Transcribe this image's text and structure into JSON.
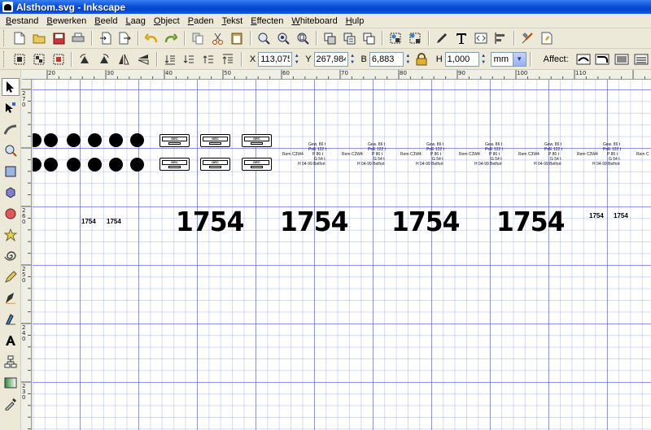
{
  "window": {
    "title": "Alsthom.svg - Inkscape"
  },
  "menu": [
    "Bestand",
    "Bewerken",
    "Beeld",
    "Laag",
    "Object",
    "Paden",
    "Tekst",
    "Effecten",
    "Whiteboard",
    "Hulp"
  ],
  "controls": {
    "x_label": "X",
    "x_value": "113,075",
    "y_label": "Y",
    "y_value": "267,984",
    "w_label": "B",
    "w_value": "6,883",
    "h_label": "H",
    "h_value": "1,000",
    "unit": "mm",
    "affect_label": "Affect:"
  },
  "ruler": {
    "top": [
      "20",
      "30",
      "40",
      "50",
      "60",
      "70",
      "80",
      "90",
      "100",
      "110"
    ],
    "left": [
      "270",
      "260",
      "250",
      "240",
      "230"
    ]
  },
  "drawing": {
    "plate_text": "GEC ALSTHOM",
    "number": "1754",
    "weight": {
      "gew": "Gew.  86 t",
      "pe": "PeE  122 t",
      "rem": "Rem C3W4",
      "p": "P   86 t",
      "g": "G   54 t",
      "h": "H 04-99 Belfort",
      "rem_cut": "Rem C"
    }
  },
  "colors": {
    "titlebar": "#0a4fd8",
    "grid_major": "#4a5ae6",
    "grid_minor": "#8296f0",
    "chrome": "#ece9d8"
  }
}
